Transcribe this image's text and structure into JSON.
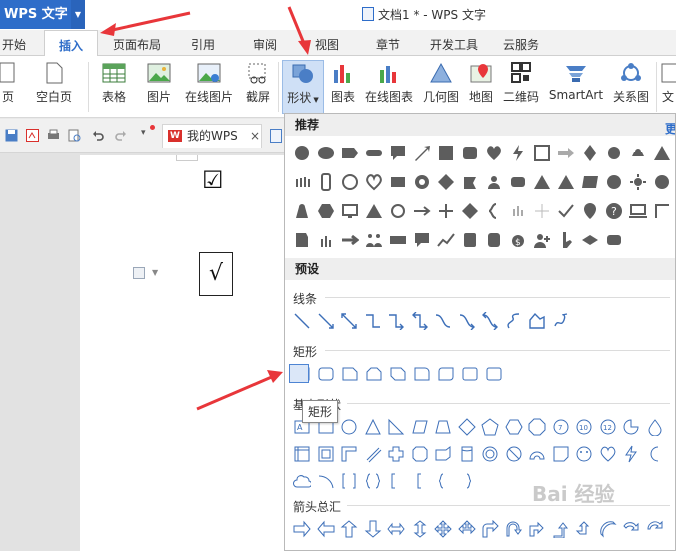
{
  "app": {
    "name": "WPS 文字",
    "doc_title": "文档1 * - WPS 文字"
  },
  "tabs": [
    "开始",
    "插入",
    "页面布局",
    "引用",
    "审阅",
    "视图",
    "章节",
    "开发工具",
    "云服务"
  ],
  "active_tab": "插入",
  "ribbon": {
    "partial_left": "页",
    "items": [
      "空白页",
      "表格",
      "图片",
      "在线图片",
      "截屏",
      "形状",
      "图表",
      "在线图表",
      "几何图",
      "地图",
      "二维码",
      "SmartArt",
      "关系图",
      "文"
    ]
  },
  "quick_tab": {
    "label": "我的WPS",
    "close": "×"
  },
  "document": {
    "checked_box": "☑",
    "check_mark": "√"
  },
  "shapes_panel": {
    "recommended_header": "推荐",
    "recommended_more": "更",
    "preset_header": "预设",
    "line_label": "线条",
    "rect_label": "矩形",
    "basic_label": "基本形状",
    "arrows_label": "箭头总汇",
    "tooltip": "矩形"
  },
  "colors": {
    "accent": "#2e6dc9",
    "red_arrow": "#e8363a",
    "shape_gray": "#5d5d5d",
    "shape_blue": "#4a7ec6"
  },
  "watermark": "Bai 经验"
}
